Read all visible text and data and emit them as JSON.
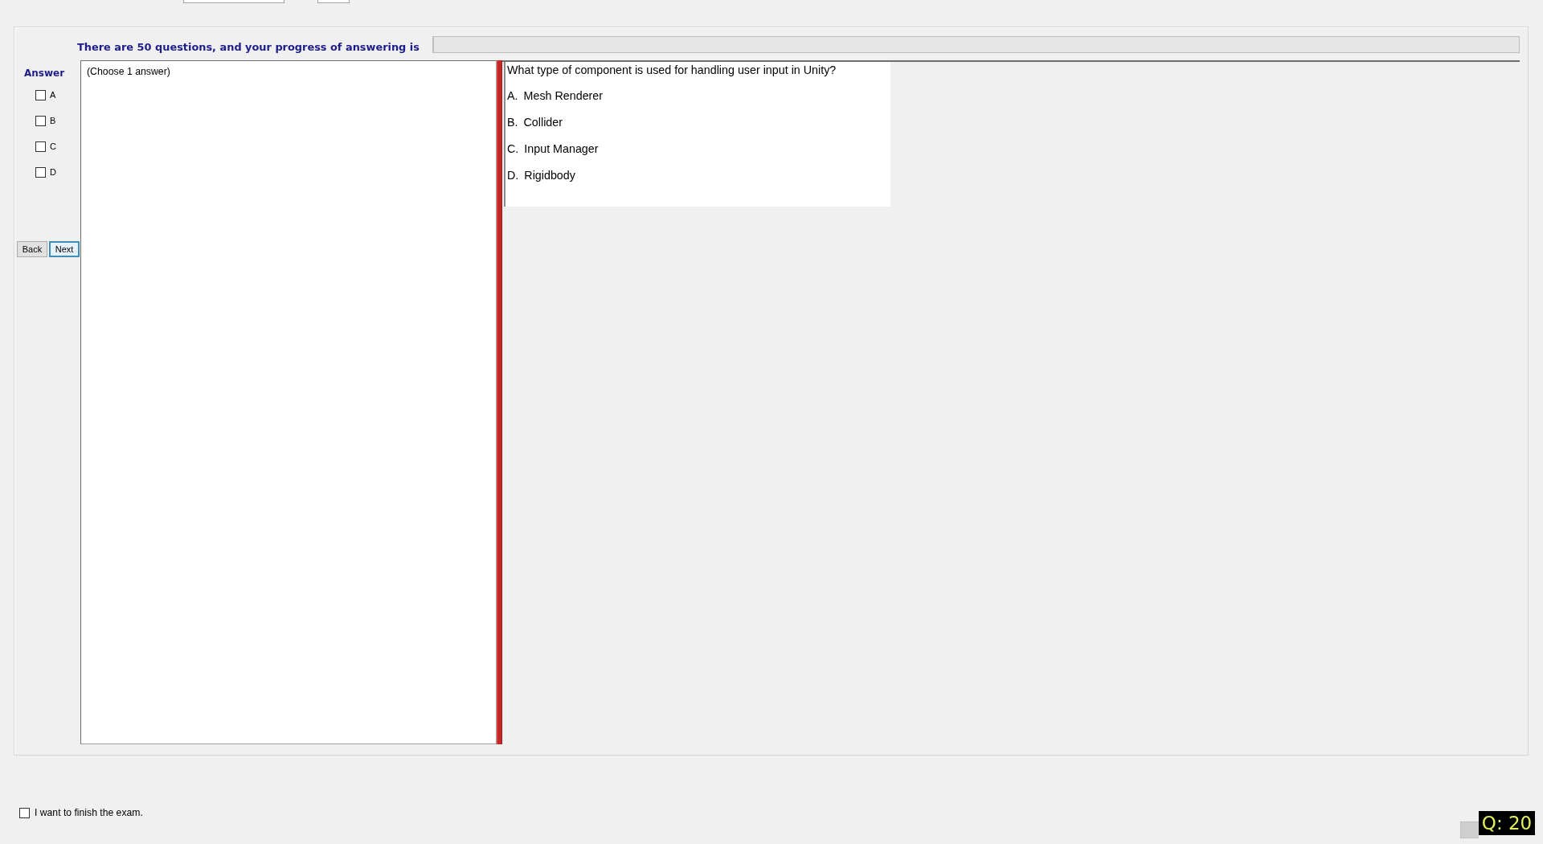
{
  "progress": {
    "text": "There are 50 questions, and your progress of answering is",
    "level": 0
  },
  "answer_panel": {
    "title": "Answer",
    "options": [
      {
        "label": "A",
        "checked": false
      },
      {
        "label": "B",
        "checked": false
      },
      {
        "label": "C",
        "checked": false
      },
      {
        "label": "D",
        "checked": false
      }
    ]
  },
  "buttons": [
    {
      "label": "Back",
      "focused": false
    },
    {
      "label": "Next",
      "focused": true
    }
  ],
  "answer_note": "(Choose 1 answer)",
  "question": {
    "text": "What type of component is used for handling user input in Unity?",
    "choices": [
      {
        "letter": "A.",
        "text": "Mesh Renderer"
      },
      {
        "letter": "B.",
        "text": "Collider"
      },
      {
        "letter": "C.",
        "text": "Input Manager"
      },
      {
        "letter": "D.",
        "text": "Rigidbody"
      }
    ]
  },
  "finish": {
    "label": "I want to finish the exam.",
    "checked": false
  },
  "question_badge": "Q: 20"
}
